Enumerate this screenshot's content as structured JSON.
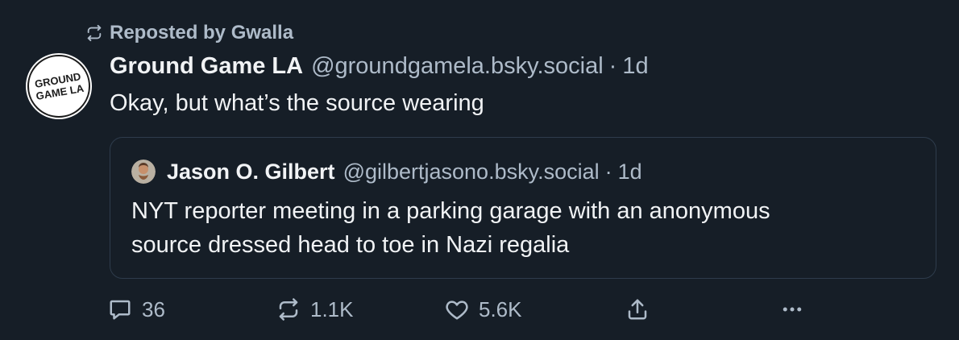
{
  "colors": {
    "background": "#161e27",
    "text_primary": "#f1f3f5",
    "text_muted": "#aebbc9",
    "border": "#2e3c4c"
  },
  "repost": {
    "icon": "repost-icon",
    "label": "Reposted by Gwalla"
  },
  "post": {
    "avatar": {
      "icon": "ground-game-la-logo",
      "text_line1": "GROUND",
      "text_line2": "GAME LA"
    },
    "display_name": "Ground Game LA",
    "handle": "@groundgamela.bsky.social",
    "separator": "·",
    "time": "1d",
    "text": "Okay, but what’s the source wearing"
  },
  "quote": {
    "avatar_icon": "user-avatar",
    "display_name": "Jason O. Gilbert",
    "handle": "@gilbertjasono.bsky.social",
    "separator": "·",
    "time": "1d",
    "text_line1": "NYT reporter meeting in a parking garage with an anonymous",
    "text_line2": "source dressed head to toe in Nazi regalia"
  },
  "actions": {
    "reply": {
      "icon": "reply-icon",
      "count": "36"
    },
    "repost": {
      "icon": "repost-icon",
      "count": "1.1K"
    },
    "like": {
      "icon": "heart-icon",
      "count": "5.6K"
    },
    "share": {
      "icon": "share-icon"
    },
    "more": {
      "icon": "more-icon"
    }
  }
}
